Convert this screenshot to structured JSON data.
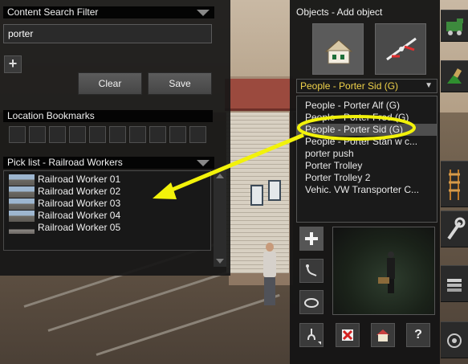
{
  "left": {
    "search": {
      "title": "Content Search Filter",
      "query": "porter",
      "add_symbol": "+",
      "clear_label": "Clear",
      "save_label": "Save"
    },
    "bookmarks": {
      "title": "Location Bookmarks"
    },
    "picklist": {
      "title": "Pick list - Railroad Workers",
      "items": [
        "Railroad Worker 01",
        "Railroad Worker 02",
        "Railroad Worker 03",
        "Railroad Worker 04",
        "Railroad Worker 05"
      ]
    }
  },
  "objects": {
    "title": "Objects - Add object",
    "category": "People - Porter Sid (G)",
    "items": [
      "People - Porter Alf (G)",
      "People - Porter Fred (G)",
      "People - Porter Sid (G)",
      "People - Porter Stan w c...",
      "porter push",
      "Porter Trolley",
      "Porter Trolley 2",
      "Vehic. VW Transporter C..."
    ],
    "selected_index": 2
  },
  "icons": {
    "top_tools": [
      "house-icon",
      "rail-switch-icon"
    ],
    "side_tools": [
      "plus-icon",
      "pick-hook-icon",
      "rotate-ring-icon"
    ],
    "bottom_tools": [
      "drag-handle-icon",
      "delete-icon",
      "object-info-icon",
      "help-icon"
    ],
    "help_symbol": "?",
    "far_right": [
      "train-icon",
      "terrain-paint-icon",
      "track-icon",
      "wrench-icon",
      "layers-icon",
      "settings-dial-icon"
    ]
  },
  "colors": {
    "annotation": "#f2f20a",
    "dropdown_text": "#f0d24a",
    "panel_bg": "#161616"
  }
}
